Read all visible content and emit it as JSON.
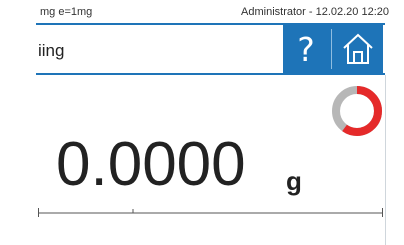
{
  "status_bar": {
    "left_text": "mg  e=1mg",
    "right_text": "Administrator - 12.02.20 12:20"
  },
  "header": {
    "title": "iing",
    "help_label": "?",
    "accent_color": "#1e74b8"
  },
  "icons": {
    "help": "question-mark-icon",
    "home": "home-icon",
    "ring": "ring-indicator-icon"
  },
  "ring_indicator": {
    "filled_fraction": 0.6,
    "fill_color": "#e52a2a",
    "track_color": "#b7b7b7"
  },
  "weight": {
    "value": "0.0000",
    "unit": "g"
  },
  "colors": {
    "accent": "#1e74b8",
    "ring_red": "#e52a2a",
    "ring_gray": "#b7b7b7"
  }
}
